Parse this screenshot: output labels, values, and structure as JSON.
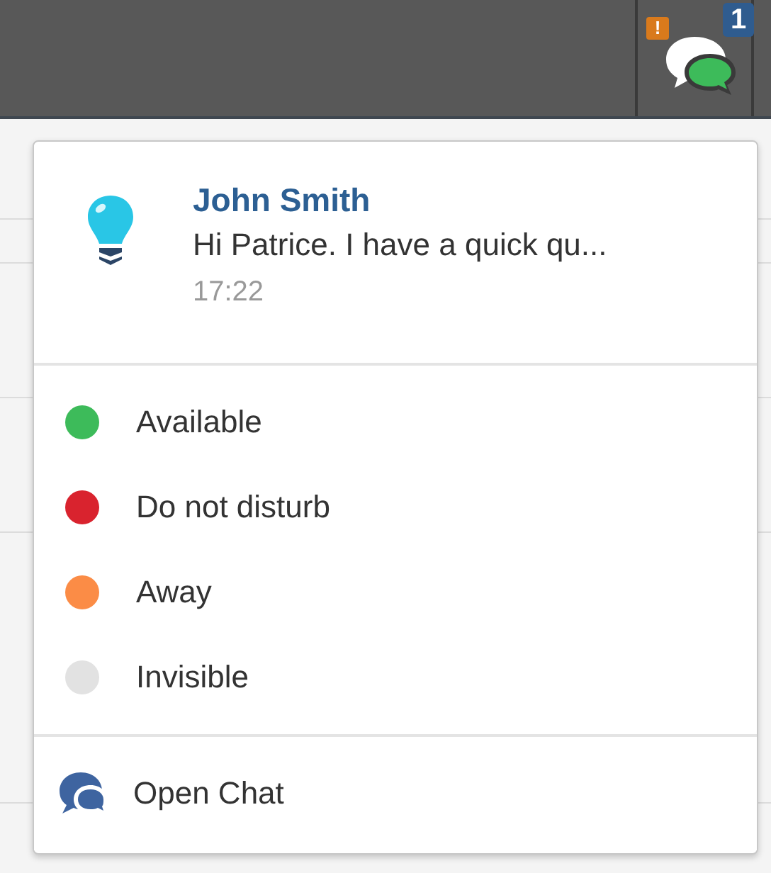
{
  "topbar": {
    "alert_badge": "!",
    "chat_badge": "1"
  },
  "notification": {
    "sender": "John Smith",
    "message": "Hi Patrice. I have a quick qu...",
    "time": "17:22"
  },
  "statuses": [
    {
      "label": "Available",
      "color": "#3dbb5a"
    },
    {
      "label": "Do not disturb",
      "color": "#d9232e"
    },
    {
      "label": "Away",
      "color": "#fb8c46"
    },
    {
      "label": "Invisible",
      "color": "#e2e2e2"
    }
  ],
  "open_chat": {
    "label": "Open Chat"
  }
}
